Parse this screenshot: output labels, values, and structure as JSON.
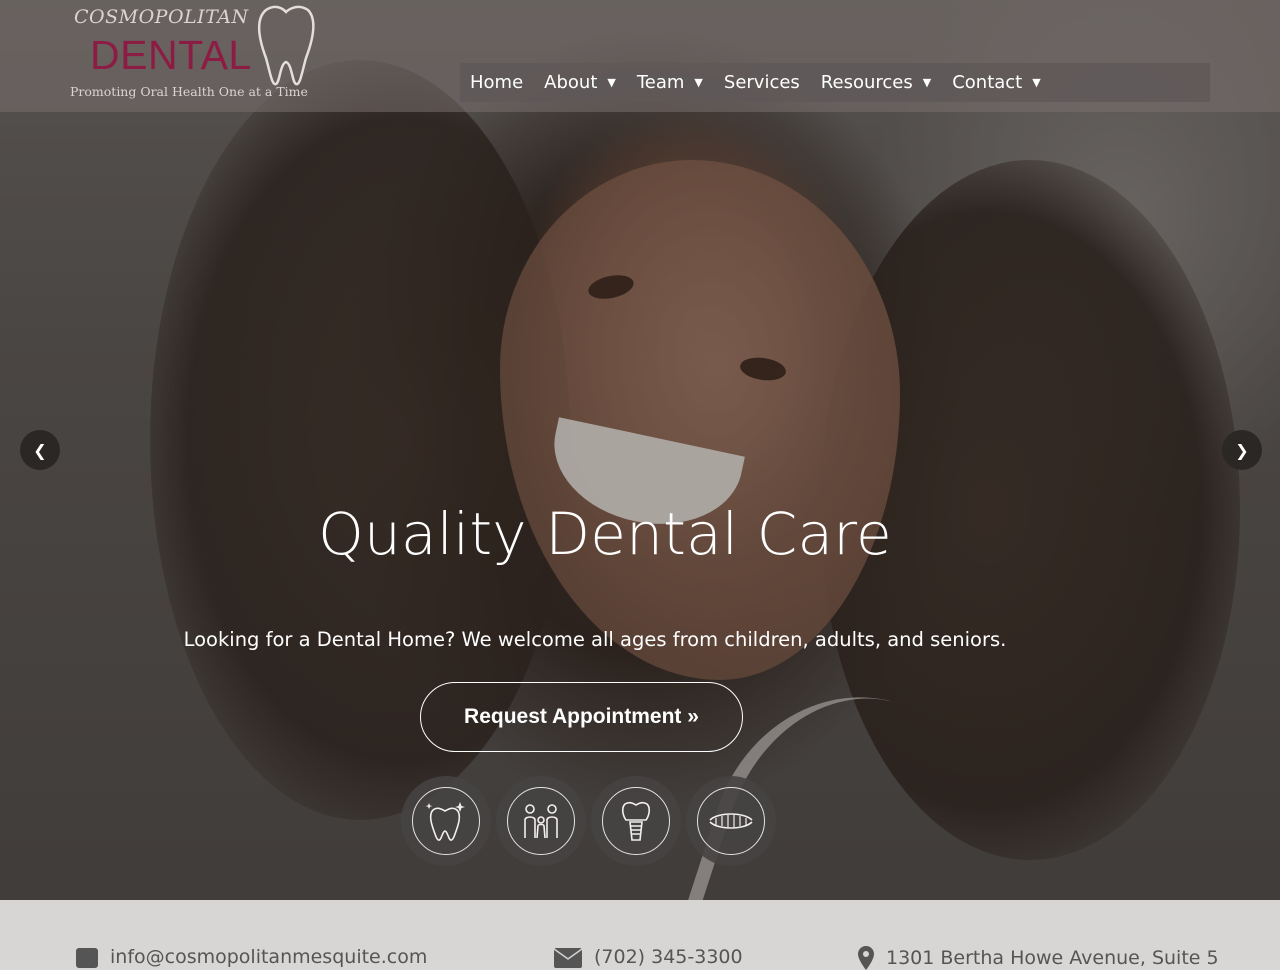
{
  "brand": {
    "name_top": "COSMOPOLITAN",
    "name_main": "DENTAL",
    "tagline": "Promoting Oral Health One at a Time",
    "accent_color": "#8d1c44"
  },
  "nav": {
    "items": [
      {
        "label": "Home",
        "has_dropdown": false
      },
      {
        "label": "About",
        "has_dropdown": true
      },
      {
        "label": "Team",
        "has_dropdown": true
      },
      {
        "label": "Services",
        "has_dropdown": false
      },
      {
        "label": "Resources",
        "has_dropdown": true
      },
      {
        "label": "Contact",
        "has_dropdown": true
      }
    ],
    "caret": "▼"
  },
  "hero": {
    "headline": "Quality Dental Care",
    "subtitle": "Looking for a Dental Home? We welcome all ages from children, adults, and seniors.",
    "cta_label": "Request Appointment »",
    "prev_arrow": "❮",
    "next_arrow": "❯",
    "feature_icons": [
      "sparkling-tooth-icon",
      "family-icon",
      "dental-implant-icon",
      "dentures-icon"
    ]
  },
  "contact_bar": {
    "email": "info@cosmopolitanmesquite.com",
    "phone": "(702) 345-3300",
    "address": "1301 Bertha Howe Avenue, Suite 5"
  }
}
